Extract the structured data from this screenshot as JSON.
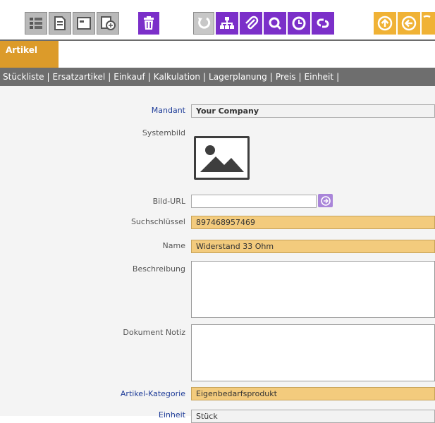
{
  "colors": {
    "tab_bg": "#dc9b2a",
    "subnav_bg": "#6e6e6e",
    "highlight_field": "#f3cb7d",
    "label_blue": "#1f3d99",
    "icon_purple": "#7b2fc9",
    "icon_orange": "#f0b235"
  },
  "toolbar": {
    "icons": [
      "list-view-icon",
      "document-icon",
      "form-icon",
      "globe-icon",
      "trash-icon",
      "undo-icon",
      "hierarchy-icon",
      "paperclip-icon",
      "search-icon",
      "clock-icon",
      "link-icon",
      "arrow-up-icon",
      "arrow-left-icon"
    ]
  },
  "tab": {
    "label": "Artikel"
  },
  "subnav": {
    "items": [
      "Stückliste",
      "Ersatzartikel",
      "Einkauf",
      "Kalkulation",
      "Lagerplanung",
      "Preis",
      "Einheit"
    ],
    "separator": "|"
  },
  "form": {
    "mandant": {
      "label": "Mandant",
      "value": "Your Company"
    },
    "systembild": {
      "label": "Systembild",
      "icon": "image-placeholder-icon"
    },
    "bild_url": {
      "label": "Bild-URL",
      "value": ""
    },
    "suchschluessel": {
      "label": "Suchschlüssel",
      "value": "897468957469"
    },
    "name": {
      "label": "Name",
      "value": "Widerstand 33 Ohm"
    },
    "beschreibung": {
      "label": "Beschreibung",
      "value": ""
    },
    "dokument_notiz": {
      "label": "Dokument Notiz",
      "value": ""
    },
    "artikel_kategorie": {
      "label": "Artikel-Kategorie",
      "value": "Eigenbedarfsprodukt"
    },
    "einheit": {
      "label": "Einheit",
      "value": "Stück"
    }
  }
}
